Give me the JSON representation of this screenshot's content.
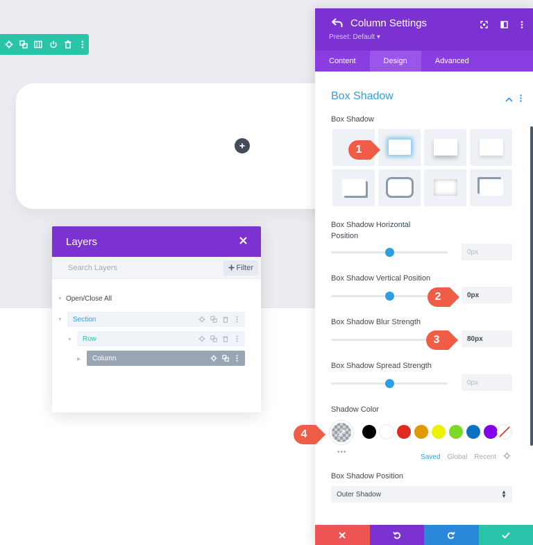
{
  "layers": {
    "title": "Layers",
    "search_placeholder": "Search Layers",
    "filter_label": "Filter",
    "open_close_label": "Open/Close All",
    "items": [
      {
        "label": "Section"
      },
      {
        "label": "Row"
      },
      {
        "label": "Column"
      }
    ]
  },
  "panel": {
    "title": "Column Settings",
    "preset": "Preset: Default ▾",
    "tabs": [
      "Content",
      "Design",
      "Advanced"
    ],
    "active_tab": "Design",
    "section_title": "Box Shadow",
    "box_shadow_label": "Box Shadow",
    "fields": {
      "horizontal": {
        "label_line1": "Box Shadow Horizontal",
        "label_line2": "Position",
        "value": "0px",
        "slider_fraction": 0.5
      },
      "vertical": {
        "label": "Box Shadow Vertical Position",
        "value": "0px",
        "slider_fraction": 0.5
      },
      "blur": {
        "label": "Box Shadow Blur Strength",
        "value": "80px",
        "slider_fraction": 1.0
      },
      "spread": {
        "label": "Box Shadow Spread Strength",
        "value": "0px",
        "slider_fraction": 0.5
      }
    },
    "shadow_color_label": "Shadow Color",
    "swatches": [
      "#000000",
      "#ffffff",
      "#e02b20",
      "#e09900",
      "#edf000",
      "#7cda24",
      "#0c71c3",
      "#8300e9"
    ],
    "palette_tabs": [
      "Saved",
      "Global",
      "Recent"
    ],
    "more_dots": "•••",
    "position_label": "Box Shadow Position",
    "position_value": "Outer Shadow",
    "bottom_colors": [
      "#ef5555",
      "#7b32d1",
      "#2b87da",
      "#29c4a9"
    ]
  },
  "markers": [
    "1",
    "2",
    "3",
    "4"
  ],
  "colors": {
    "purple": "#7b32d1",
    "blue_accent": "#2e9ee3",
    "green": "#29c4a9",
    "marker_red": "#ef5d46"
  }
}
